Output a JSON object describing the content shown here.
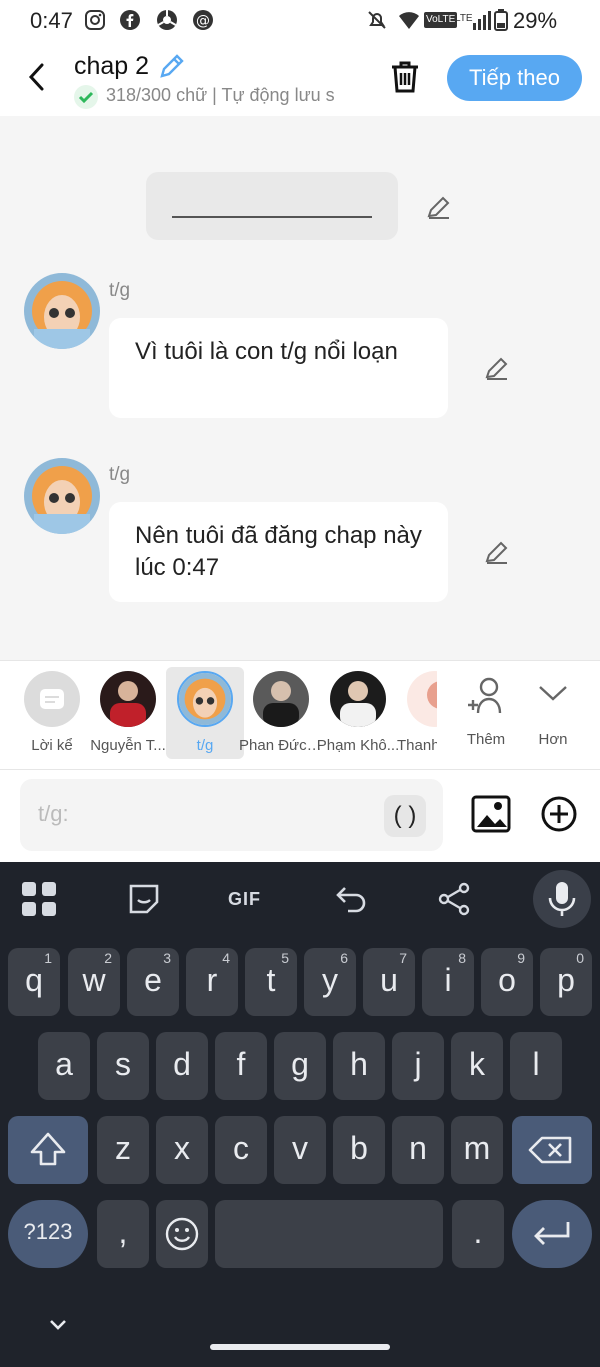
{
  "status_bar": {
    "time": "0:47",
    "battery": "29%",
    "lte_badge": "LTE",
    "volte_badge": "VoLTE"
  },
  "header": {
    "title": "chap 2",
    "subtitle": "318/300 chữ | Tự động lưu s",
    "next_label": "Tiếp theo"
  },
  "messages": [
    {
      "name": "t/g",
      "text": "Vì tuôi là con t/g nổi loạn"
    },
    {
      "name": "t/g",
      "text": "Nên tuôi đã đăng chap này lúc 0:47"
    }
  ],
  "characters": [
    {
      "label": "Lời kể"
    },
    {
      "label": "Nguyễn T..."
    },
    {
      "label": "t/g"
    },
    {
      "label": "Phan Đức ..."
    },
    {
      "label": "Phạm Khô..."
    },
    {
      "label": "Thanh"
    }
  ],
  "actions": {
    "add_label": "Thêm",
    "more_label": "Hơn"
  },
  "input": {
    "placeholder": "t/g:",
    "paren": "( )"
  },
  "keyboard": {
    "row1": [
      "q",
      "w",
      "e",
      "r",
      "t",
      "y",
      "u",
      "i",
      "o",
      "p"
    ],
    "row1_hints": [
      "1",
      "2",
      "3",
      "4",
      "5",
      "6",
      "7",
      "8",
      "9",
      "0"
    ],
    "row2": [
      "a",
      "s",
      "d",
      "f",
      "g",
      "h",
      "j",
      "k",
      "l"
    ],
    "row3": [
      "z",
      "x",
      "c",
      "v",
      "b",
      "n",
      "m"
    ],
    "num_key": "?123",
    "comma": ",",
    "period": ".",
    "gif": "GIF"
  },
  "colors": {
    "accent": "#58a8f2",
    "keyboard_bg": "#1f232b",
    "key": "#3c4048",
    "key_dark": "#4a5b78"
  }
}
